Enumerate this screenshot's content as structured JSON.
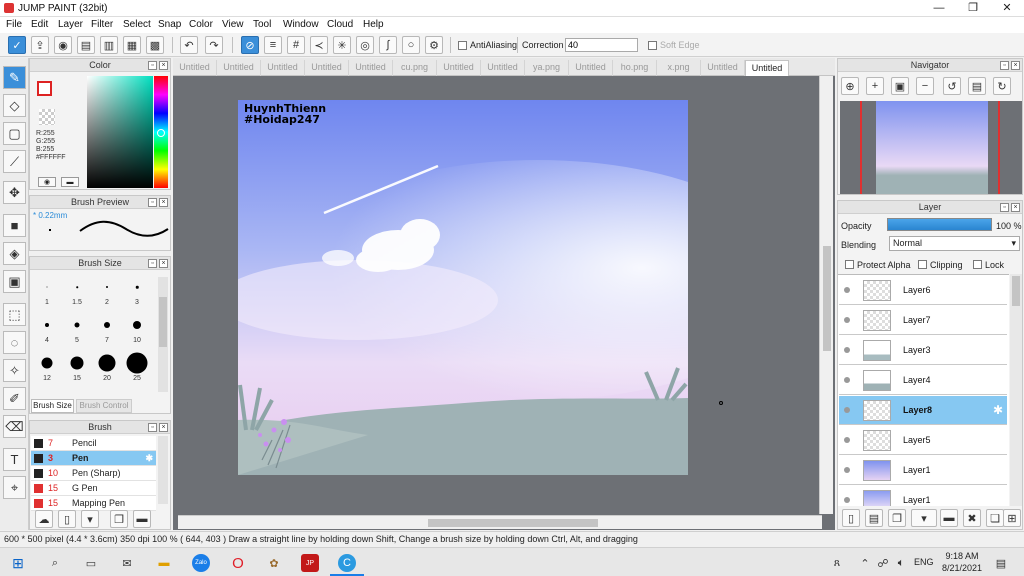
{
  "window": {
    "title": "JUMP PAINT (32bit)",
    "minimize": "—",
    "maximize": "❐",
    "close": "✕"
  },
  "menu": [
    "File",
    "Edit",
    "Layer",
    "Filter",
    "Select",
    "Snap",
    "Color",
    "View",
    "Tool",
    "Window",
    "Cloud",
    "Help"
  ],
  "toolbar": {
    "antialias_label": "AntiAliasing",
    "correction_label": "Correction",
    "correction_value": "40",
    "soft_edge_label": "Soft Edge"
  },
  "tabs": [
    "Untitled",
    "Untitled",
    "Untitled",
    "Untitled",
    "Untitled",
    "cu.png",
    "Untitled",
    "Untitled",
    "ya.png",
    "Untitled",
    "ho.png",
    "x.png",
    "Untitled",
    "Untitled"
  ],
  "color_panel": {
    "title": "Color",
    "r": "R:255",
    "g": "G:255",
    "b": "B:255",
    "hex": "#FFFFFF"
  },
  "brush_preview": {
    "title": "Brush Preview",
    "size": "* 0.22mm"
  },
  "brush_size": {
    "title": "Brush Size",
    "sizes": [
      "1",
      "1.5",
      "2",
      "3",
      "4",
      "5",
      "7",
      "10",
      "12",
      "15",
      "20",
      "25"
    ],
    "tab_active": "Brush Size",
    "tab_inactive": "Brush Control"
  },
  "brush_panel": {
    "title": "Brush",
    "items": [
      {
        "size": "7",
        "name": "Pencil",
        "color": "#222222"
      },
      {
        "size": "3",
        "name": "Pen",
        "color": "#222222"
      },
      {
        "size": "10",
        "name": "Pen (Sharp)",
        "color": "#222222"
      },
      {
        "size": "15",
        "name": "G Pen",
        "color": "#e03030"
      },
      {
        "size": "15",
        "name": "Mapping Pen",
        "color": "#e03030"
      }
    ]
  },
  "canvas": {
    "watermark_line1": "HuynhThienn",
    "watermark_line2": "#Hoidap247"
  },
  "navigator": {
    "title": "Navigator"
  },
  "layer_panel": {
    "title": "Layer",
    "opacity_label": "Opacity",
    "opacity_value": "100 %",
    "opacity": 1.0,
    "blending_label": "Blending",
    "blending_value": "Normal",
    "protect_alpha": "Protect Alpha",
    "clipping": "Clipping",
    "lock": "Lock",
    "layers": [
      "Layer6",
      "Layer7",
      "Layer3",
      "Layer4",
      "Layer8",
      "Layer5",
      "Layer1",
      "Layer1"
    ]
  },
  "status": {
    "text": "600 * 500 pixel   (4.4 * 3.6cm)   350 dpi   100 %   ( 644, 403 )   Draw a straight line by holding down Shift, Change a brush size by holding down Ctrl, Alt, and dragging"
  },
  "taskbar": {
    "lang": "ENG",
    "time": "9:18 AM",
    "date": "8/21/2021"
  },
  "colors": {
    "accent": "#3b8fd9",
    "selected_row": "#86c8f2",
    "workspace": "#6d7075"
  }
}
